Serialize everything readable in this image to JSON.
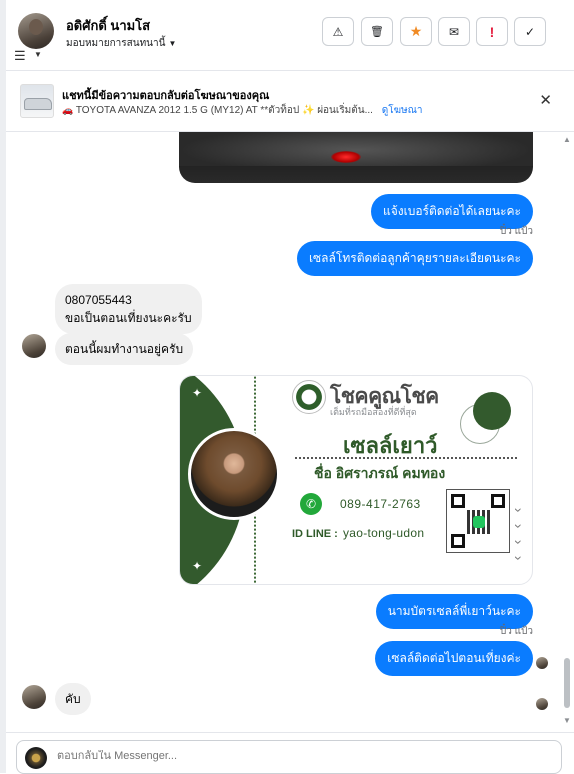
{
  "header": {
    "name": "อดิศักดิ์ นามโส",
    "assign_label": "มอบหมายการสนทนานี้"
  },
  "toolbar": {
    "buttons": [
      {
        "icon": "⚠",
        "name": "warning",
        "color": "#1c1e21"
      },
      {
        "icon": "🗑",
        "name": "trash",
        "color": "#1c1e21"
      },
      {
        "icon": "★",
        "name": "star",
        "color": "#f08a24"
      },
      {
        "icon": "✉",
        "name": "mark-unread",
        "color": "#1c1e21"
      },
      {
        "icon": "!",
        "name": "priority",
        "color": "#e41e3f"
      },
      {
        "icon": "✓",
        "name": "done",
        "color": "#1c1e21"
      }
    ]
  },
  "ad_context": {
    "title": "แชทนี้มีข้อความตอบกลับต่อโฆษณาของคุณ",
    "car_icon": "🚗",
    "subtitle": "TOYOTA AVANZA 2012 1.5 G (MY12) AT **ตัวท็อป ✨ ผ่อนเริ่มต้น...",
    "link": "ดูโฆษณา"
  },
  "messages": [
    {
      "dir": "out",
      "text": "แจ้งเบอร์ติดต่อได้เลยนะคะ"
    },
    {
      "dir": "seen",
      "text": "ปิ๋ว แป้ว"
    },
    {
      "dir": "out",
      "text": "เซลล์โทรติดต่อลูกค้าคุยรายละเอียดนะคะ"
    },
    {
      "dir": "in",
      "line1": "0807055443",
      "line2": "ขอเป็นตอนเที่ยงนะคะรับ"
    },
    {
      "dir": "in",
      "text": "ตอนนี้ผมทำงานอยู่ครับ"
    },
    {
      "dir": "out",
      "text": "นามบัตรเซลล์พี่เยาว์นะคะ"
    },
    {
      "dir": "seen",
      "text": "ปิ๋ว แป้ว"
    },
    {
      "dir": "out",
      "text": "เซลล์ติดต่อไปตอนเที่ยงค่ะ"
    },
    {
      "dir": "in",
      "text": "คับ"
    }
  ],
  "business_card": {
    "brand": "โชคคูณโชค",
    "brand_tagline": "เต็มที่รถมือสองที่ดีที่สุด",
    "role": "เซลล์เยาว์",
    "full_name": "ชื่อ อิศราภรณ์ คมทอง",
    "phone": "089-417-2763",
    "line_label": "ID LINE :",
    "line_id": "yao-tong-udon"
  },
  "composer": {
    "placeholder": "ตอบกลับใน Messenger..."
  }
}
